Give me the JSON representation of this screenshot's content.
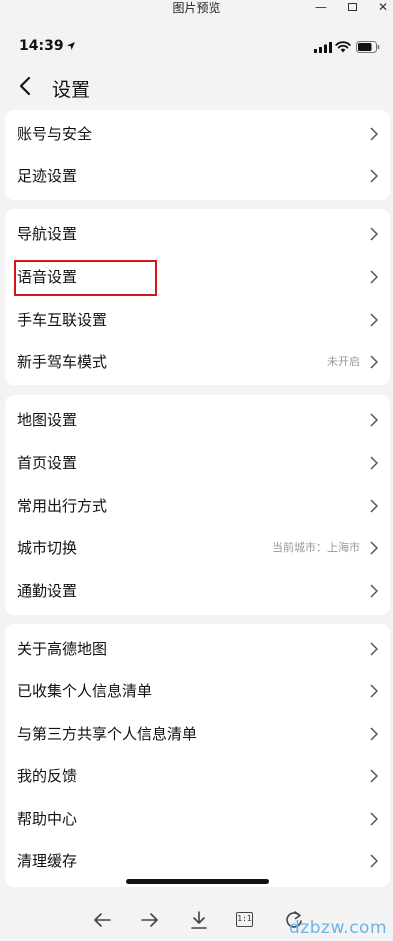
{
  "window": {
    "title": "图片预览",
    "minimize": "—",
    "close": "✕"
  },
  "status_bar": {
    "time": "14:39"
  },
  "header": {
    "title": "设置"
  },
  "groups": [
    {
      "items": [
        {
          "label": "账号与安全",
          "value": ""
        },
        {
          "label": "足迹设置",
          "value": ""
        }
      ]
    },
    {
      "items": [
        {
          "label": "导航设置",
          "value": ""
        },
        {
          "label": "语音设置",
          "value": "",
          "highlighted": true
        },
        {
          "label": "手车互联设置",
          "value": ""
        },
        {
          "label": "新手驾车模式",
          "value": "未开启"
        }
      ]
    },
    {
      "items": [
        {
          "label": "地图设置",
          "value": ""
        },
        {
          "label": "首页设置",
          "value": ""
        },
        {
          "label": "常用出行方式",
          "value": ""
        },
        {
          "label": "城市切换",
          "value": "当前城市：上海市"
        },
        {
          "label": "通勤设置",
          "value": ""
        }
      ]
    },
    {
      "items": [
        {
          "label": "关于高德地图",
          "value": ""
        },
        {
          "label": "已收集个人信息清单",
          "value": ""
        },
        {
          "label": "与第三方共享个人信息清单",
          "value": ""
        },
        {
          "label": "我的反馈",
          "value": ""
        },
        {
          "label": "帮助中心",
          "value": ""
        },
        {
          "label": "清理缓存",
          "value": ""
        }
      ]
    }
  ],
  "toolbar": {
    "actual_size": "1:1"
  },
  "watermark": "dzbzw.com",
  "colors": {
    "highlight": "#d4161c",
    "background": "#f3f3f3",
    "card": "#ffffff",
    "secondary_text": "#999999"
  }
}
